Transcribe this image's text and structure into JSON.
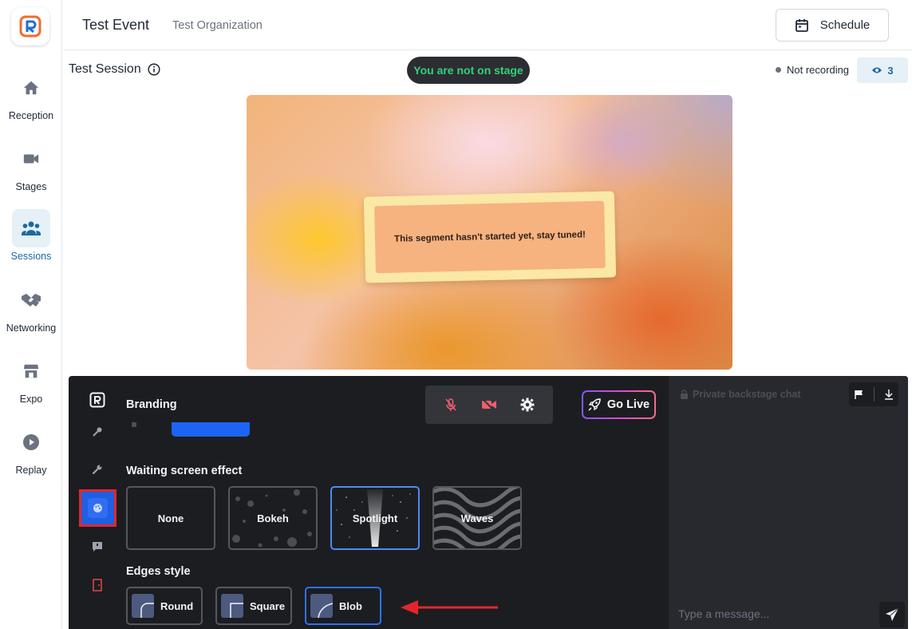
{
  "nav": {
    "items": [
      {
        "label": "Reception",
        "icon": "home-icon"
      },
      {
        "label": "Stages",
        "icon": "video-camera-icon"
      },
      {
        "label": "Sessions",
        "icon": "people-group-icon"
      },
      {
        "label": "Networking",
        "icon": "handshake-icon"
      },
      {
        "label": "Expo",
        "icon": "storefront-icon"
      },
      {
        "label": "Replay",
        "icon": "play-circle-icon"
      }
    ],
    "active": "Sessions"
  },
  "header": {
    "event_title": "Test Event",
    "organization": "Test Organization",
    "schedule_label": "Schedule"
  },
  "session": {
    "title": "Test Session",
    "stage_status": "You are not on stage",
    "recording_status": "Not recording",
    "viewer_count": "3"
  },
  "video": {
    "message": "This segment hasn't started yet, stay tuned!"
  },
  "backstage": {
    "branding_title": "Branding",
    "go_live_label": "Go Live",
    "waiting_effect_label": "Waiting screen effect",
    "effects": [
      "None",
      "Bokeh",
      "Spotlight",
      "Waves"
    ],
    "selected_effect": "Spotlight",
    "edges_label": "Edges style",
    "edges": [
      "Round",
      "Square",
      "Blob"
    ],
    "selected_edge": "Blob"
  },
  "chat": {
    "header": "Private backstage chat",
    "input_placeholder": "Type a message..."
  },
  "colors": {
    "accent": "#1a6aa3",
    "stage_text": "#33d17a",
    "selection_blue": "#2d72ff",
    "highlight_red": "#e3262b"
  }
}
